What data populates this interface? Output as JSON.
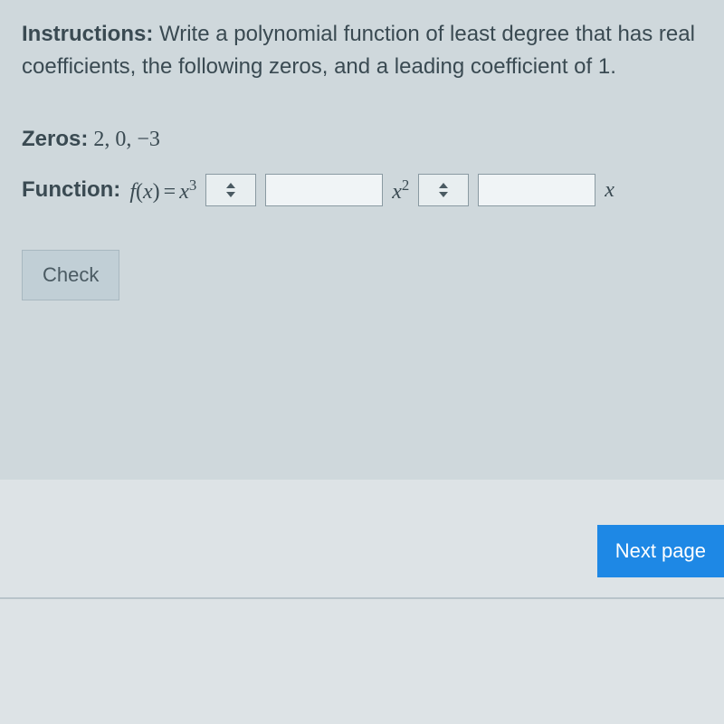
{
  "instructions": {
    "label": "Instructions:",
    "text": " Write a polynomial function of least degree that has real coefficients, the following zeros, and a leading coefficient of 1."
  },
  "zeros": {
    "label": "Zeros:",
    "values": " 2, 0, −3"
  },
  "function": {
    "label": "Function:",
    "lhs_f": "f",
    "lhs_open": "(",
    "lhs_x": "x",
    "lhs_close": ")",
    "eq": "=",
    "term1_base": "x",
    "term1_exp": "3",
    "sign1": "",
    "coef1": "",
    "term2_base": "x",
    "term2_exp": "2",
    "sign2": "",
    "coef2": "",
    "term3_base": "x"
  },
  "buttons": {
    "check": "Check",
    "next": "Next page"
  }
}
